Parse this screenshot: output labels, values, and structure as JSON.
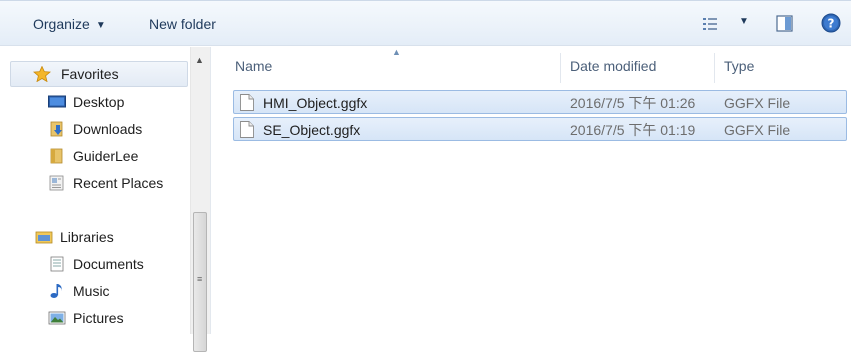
{
  "toolbar": {
    "organize_label": "Organize",
    "new_folder_label": "New folder"
  },
  "nav": {
    "favorites_label": "Favorites",
    "favorites_items": [
      "Desktop",
      "Downloads",
      "GuiderLee",
      "Recent Places"
    ],
    "libraries_label": "Libraries",
    "libraries_items": [
      "Documents",
      "Music",
      "Pictures"
    ]
  },
  "columns": {
    "name": "Name",
    "date_modified": "Date modified",
    "type": "Type"
  },
  "files": [
    {
      "name": "HMI_Object.ggfx",
      "date": "2016/7/5 下午 01:26",
      "type": "GGFX File"
    },
    {
      "name": "SE_Object.ggfx",
      "date": "2016/7/5 下午 01:19",
      "type": "GGFX File"
    }
  ],
  "colors": {
    "selection": "#d6e5f7",
    "selection_border": "#9bbbe3",
    "toolbar_bg": "#e4edf7"
  }
}
